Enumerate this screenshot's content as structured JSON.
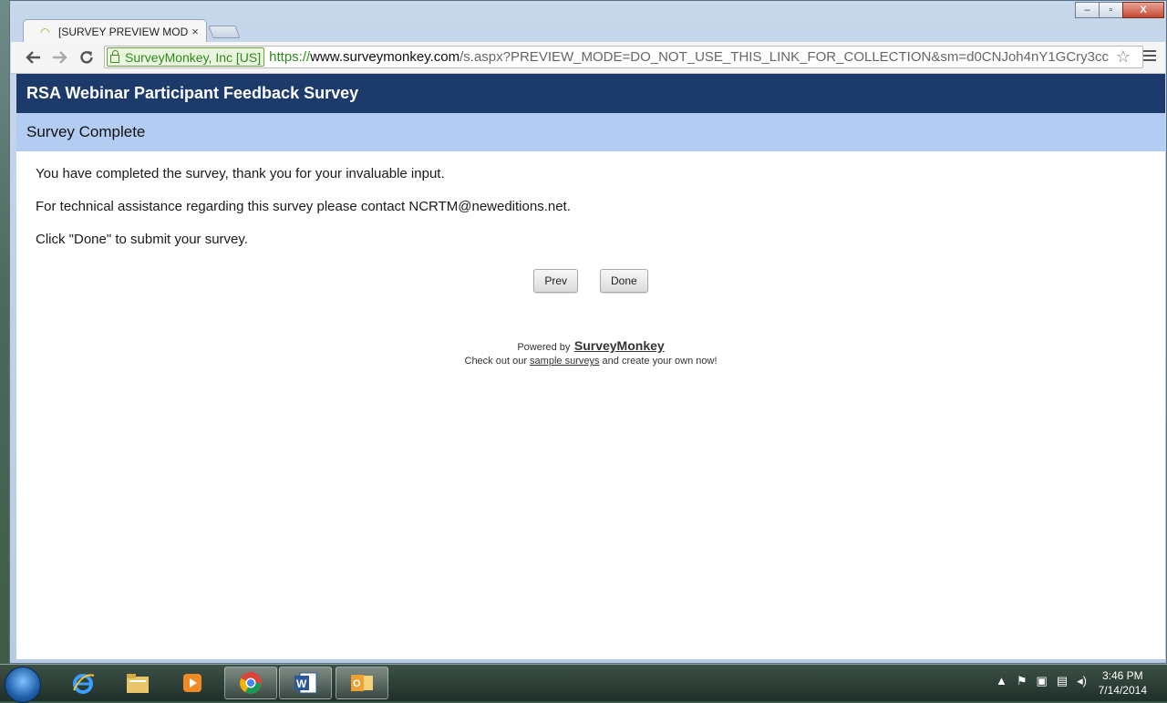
{
  "browser": {
    "tab_title": "[SURVEY PREVIEW MODE]",
    "tab_close": "×",
    "ev_label": "SurveyMonkey, Inc [US]",
    "url_scheme": "https://",
    "url_host": "www.surveymonkey.com",
    "url_path": "/s.aspx?PREVIEW_MODE=DO_NOT_USE_THIS_LINK_FOR_COLLECTION&sm=d0CNJoh4nY1GCry3cc",
    "window_controls": {
      "minimize": "‒",
      "maximize": "▫",
      "close": "X"
    }
  },
  "survey": {
    "title": "RSA Webinar Participant Feedback Survey",
    "section": "Survey Complete",
    "paragraphs": [
      "You have completed the survey, thank you for your invaluable input.",
      "For technical assistance regarding this survey please contact NCRTM@neweditions.net.",
      "Click \"Done\" to submit your survey."
    ],
    "prev_label": "Prev",
    "done_label": "Done"
  },
  "footer": {
    "powered_by": "Powered by",
    "brand": "SurveyMonkey",
    "check_out_prefix": "Check out our",
    "sample_surveys": "sample surveys",
    "check_out_suffix": "and create your own now!"
  },
  "taskbar": {
    "time": "3:46 PM",
    "date": "7/14/2014",
    "apps": [
      "internet-explorer",
      "windows-explorer",
      "media-player",
      "chrome",
      "word",
      "outlook"
    ]
  },
  "icons": {
    "back": "back-arrow-icon",
    "forward": "forward-arrow-icon",
    "reload": "reload-icon",
    "star": "bookmark-star-icon",
    "menu": "chrome-menu-icon"
  },
  "colors": {
    "header_bg": "#1c3b6b",
    "section_bg": "#b3ccf1",
    "ev_green": "#2f8a1a"
  }
}
